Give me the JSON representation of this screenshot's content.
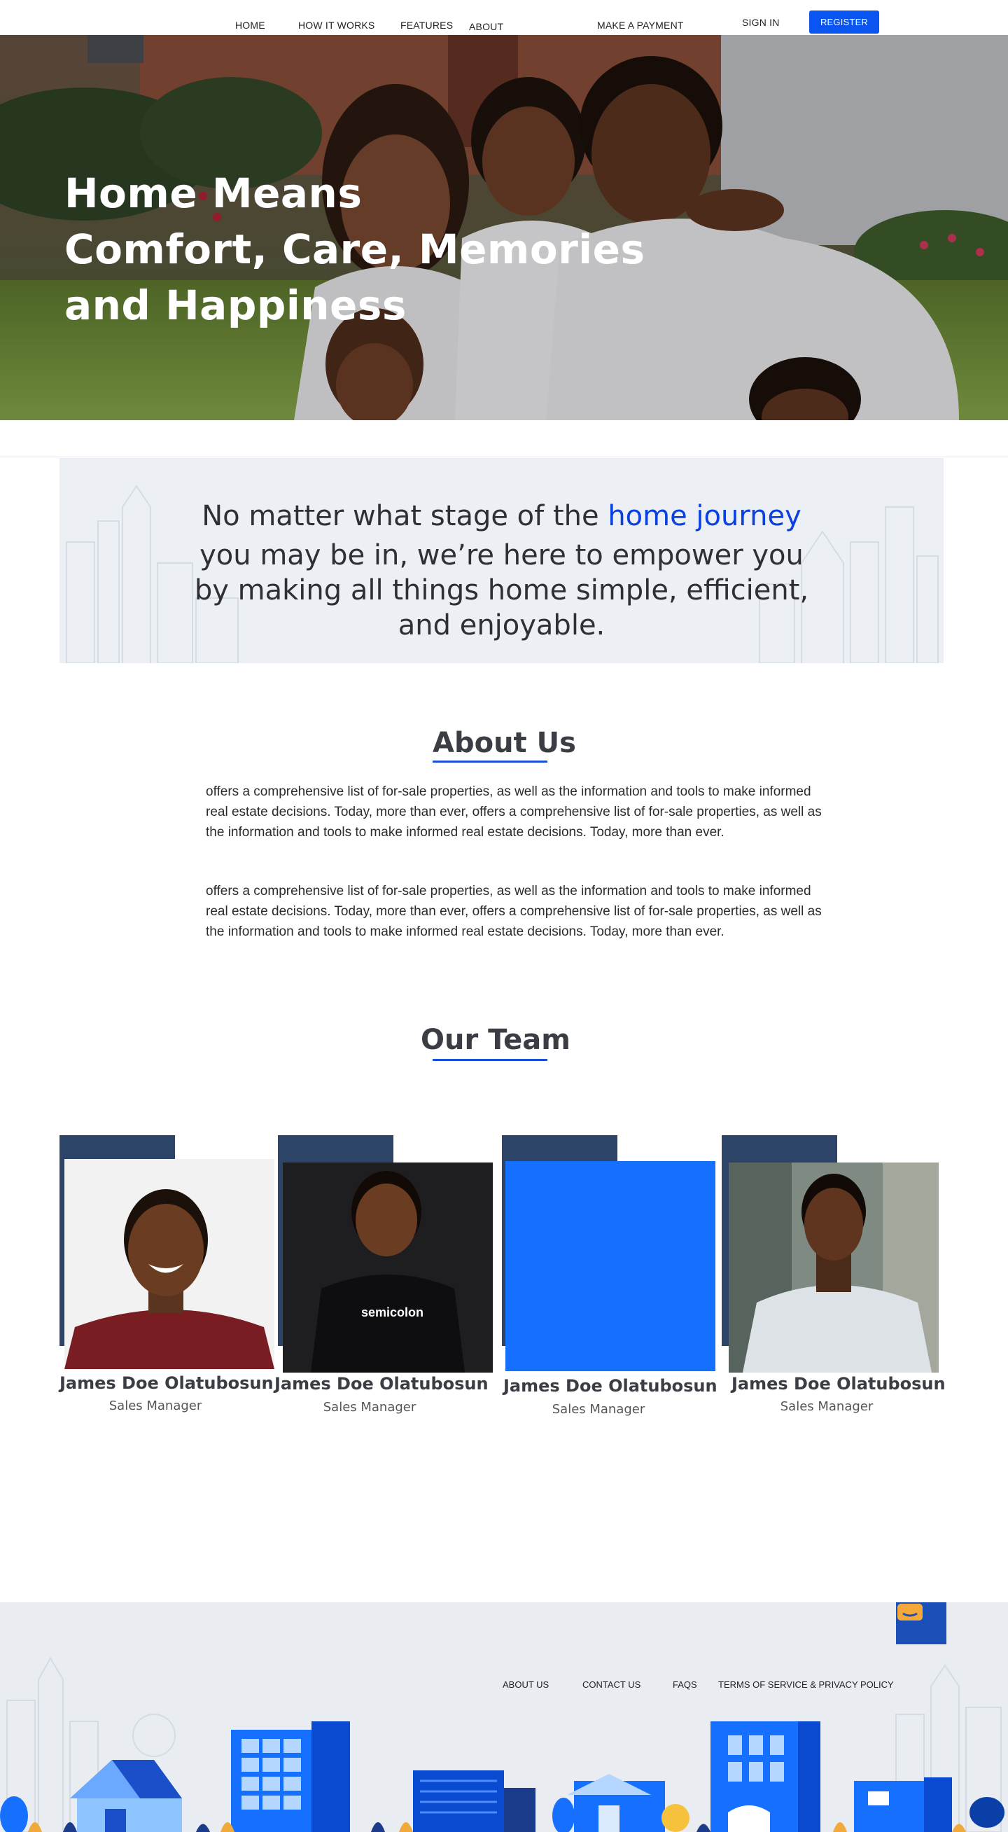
{
  "nav": {
    "home": "HOME",
    "how_it_works": "HOW IT WORKS",
    "features": "FEATURES",
    "about": "ABOUT",
    "make_payment": "MAKE A PAYMENT",
    "sign_in": "SIGN IN",
    "register": "REGISTER"
  },
  "hero": {
    "line1": "Home Means",
    "line2": "Comfort, Care, Memories",
    "line3": "and Happiness"
  },
  "mission": {
    "lead": "No matter what stage of the ",
    "highlight": "home journey",
    "rest": "you may be in, we’re here to empower you by making all things home simple, efficient, and enjoyable."
  },
  "about": {
    "title": "About Us",
    "p1": "offers a comprehensive list of for-sale properties, as well as the information and tools to make informed real estate decisions. Today, more than ever, offers a comprehensive list of for-sale properties, as well as the information and tools to make informed real estate decisions. Today, more than ever.",
    "p2": "offers a comprehensive list of for-sale properties, as well as the information and tools to make informed real estate decisions. Today, more than ever, offers a comprehensive list of for-sale properties, as well as the information and tools to make informed real estate decisions. Today, more than ever."
  },
  "team": {
    "title": "Our Team",
    "members": [
      {
        "name": "James Doe Olatubosun",
        "role": "Sales Manager"
      },
      {
        "name": "James Doe Olatubosun",
        "role": "Sales Manager"
      },
      {
        "name": "James Doe Olatubosun",
        "role": "Sales Manager"
      },
      {
        "name": "James Doe Olatubosun",
        "role": "Sales Manager"
      }
    ],
    "shirt_text": "semicolon"
  },
  "footer": {
    "about_us": "ABOUT US",
    "contact_us": "CONTACT US",
    "faqs": "FAQS",
    "terms": "TERMS OF SERVICE & PRIVACY POLICY",
    "chat_icon": "chat-bubble-icon"
  },
  "colors": {
    "brand_blue": "#0a55f0",
    "highlight_blue": "#0a3fe0",
    "card_back": "#2c4468",
    "placeholder_blue": "#1570ff",
    "footer_bg": "#e9edf2"
  }
}
